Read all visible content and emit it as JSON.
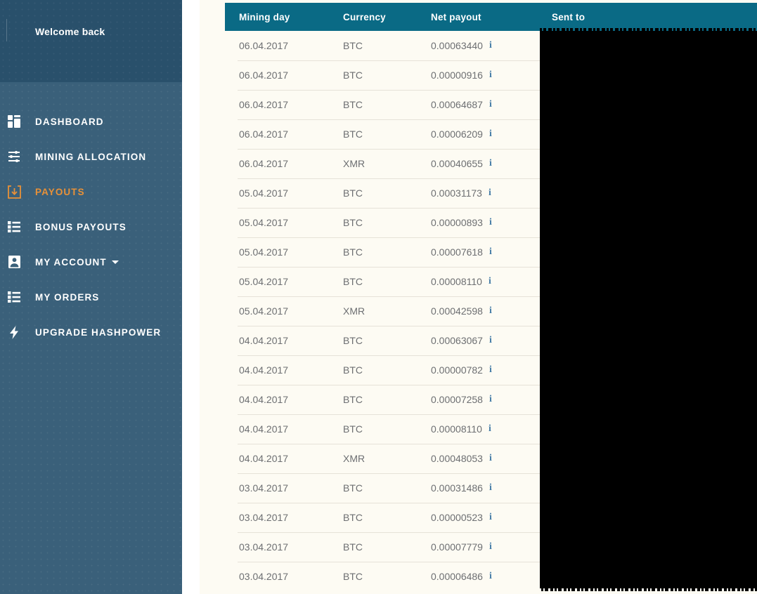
{
  "sidebar": {
    "welcome_text": "Welcome back",
    "items": [
      {
        "label": "DASHBOARD",
        "icon": "dashboard-grid-icon",
        "active": false,
        "caret": false
      },
      {
        "label": "MINING ALLOCATION",
        "icon": "sliders-icon",
        "active": false,
        "caret": false
      },
      {
        "label": "PAYOUTS",
        "icon": "download-box-icon",
        "active": true,
        "caret": false
      },
      {
        "label": "BONUS PAYOUTS",
        "icon": "list-icon",
        "active": false,
        "caret": false
      },
      {
        "label": "MY ACCOUNT",
        "icon": "user-icon",
        "active": false,
        "caret": true
      },
      {
        "label": "MY ORDERS",
        "icon": "list-icon",
        "active": false,
        "caret": false
      },
      {
        "label": "UPGRADE HASHPOWER",
        "icon": "lightning-bolt-icon",
        "active": false,
        "caret": false
      }
    ]
  },
  "colors": {
    "sidebar_bg": "#3a607a",
    "sidebar_head_bg": "#29506b",
    "accent_orange": "#e89138",
    "table_header_teal": "#0a6a85",
    "content_bg": "#fdfbf3",
    "row_divider": "#e6e2d8",
    "text_gray": "#6d6f72",
    "info_icon_blue": "#4a7fa8",
    "redaction_black": "#000000"
  },
  "table": {
    "columns": [
      "Mining day",
      "Currency",
      "Net payout",
      "Sent to"
    ],
    "info_icon_glyph": "i",
    "sent_to_redacted": true,
    "rows": [
      {
        "day": "06.04.2017",
        "currency": "BTC",
        "payout": "0.00063440",
        "sent_to": ""
      },
      {
        "day": "06.04.2017",
        "currency": "BTC",
        "payout": "0.00000916",
        "sent_to": ""
      },
      {
        "day": "06.04.2017",
        "currency": "BTC",
        "payout": "0.00064687",
        "sent_to": ""
      },
      {
        "day": "06.04.2017",
        "currency": "BTC",
        "payout": "0.00006209",
        "sent_to": ""
      },
      {
        "day": "06.04.2017",
        "currency": "XMR",
        "payout": "0.00040655",
        "sent_to": ""
      },
      {
        "day": "05.04.2017",
        "currency": "BTC",
        "payout": "0.00031173",
        "sent_to": ""
      },
      {
        "day": "05.04.2017",
        "currency": "BTC",
        "payout": "0.00000893",
        "sent_to": ""
      },
      {
        "day": "05.04.2017",
        "currency": "BTC",
        "payout": "0.00007618",
        "sent_to": ""
      },
      {
        "day": "05.04.2017",
        "currency": "BTC",
        "payout": "0.00008110",
        "sent_to": ""
      },
      {
        "day": "05.04.2017",
        "currency": "XMR",
        "payout": "0.00042598",
        "sent_to": ""
      },
      {
        "day": "04.04.2017",
        "currency": "BTC",
        "payout": "0.00063067",
        "sent_to": ""
      },
      {
        "day": "04.04.2017",
        "currency": "BTC",
        "payout": "0.00000782",
        "sent_to": ""
      },
      {
        "day": "04.04.2017",
        "currency": "BTC",
        "payout": "0.00007258",
        "sent_to": ""
      },
      {
        "day": "04.04.2017",
        "currency": "BTC",
        "payout": "0.00008110",
        "sent_to": ""
      },
      {
        "day": "04.04.2017",
        "currency": "XMR",
        "payout": "0.00048053",
        "sent_to": ""
      },
      {
        "day": "03.04.2017",
        "currency": "BTC",
        "payout": "0.00031486",
        "sent_to": ""
      },
      {
        "day": "03.04.2017",
        "currency": "BTC",
        "payout": "0.00000523",
        "sent_to": ""
      },
      {
        "day": "03.04.2017",
        "currency": "BTC",
        "payout": "0.00007779",
        "sent_to": ""
      },
      {
        "day": "03.04.2017",
        "currency": "BTC",
        "payout": "0.00006486",
        "sent_to": ""
      }
    ]
  }
}
